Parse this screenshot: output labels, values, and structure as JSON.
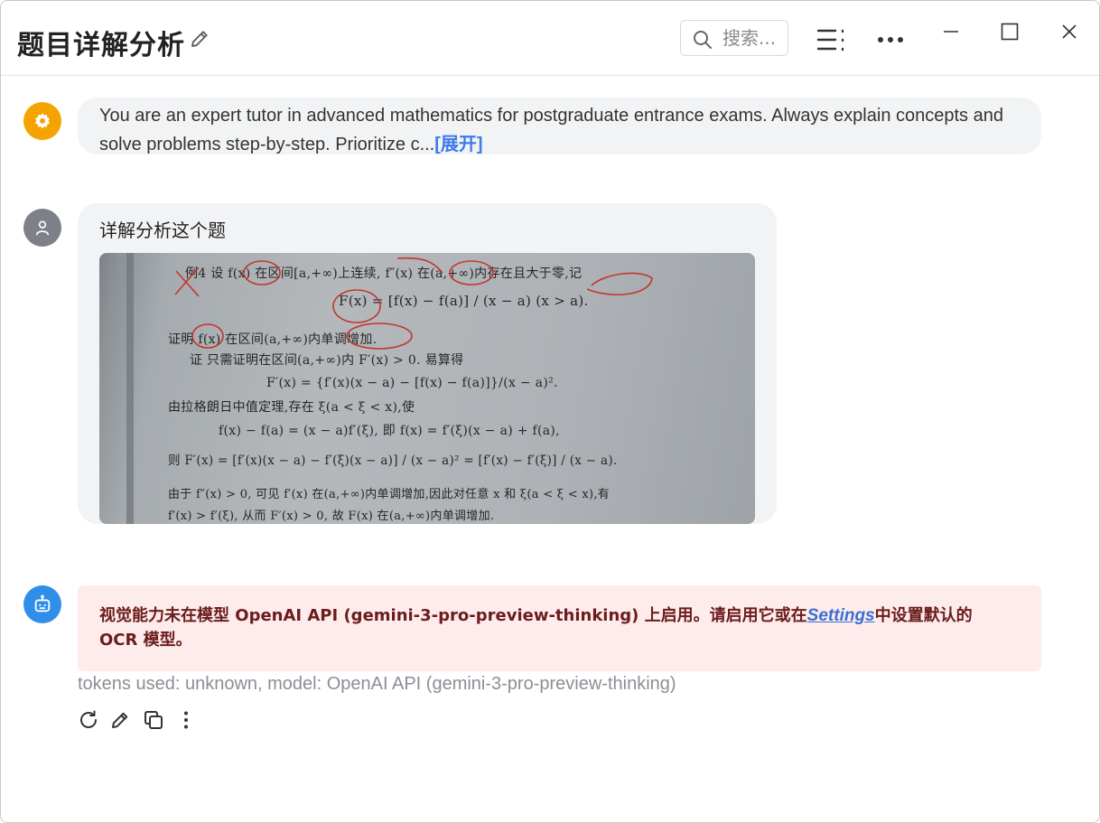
{
  "window": {
    "title": "题目详解分析",
    "search_placeholder": "搜索..."
  },
  "messages": {
    "system": {
      "text": "You are an expert tutor in advanced mathematics for postgraduate entrance exams. Always explain concepts and solve problems step-by-step. Prioritize c...",
      "expand_label": "[展开]"
    },
    "user": {
      "text": "详解分析这个题",
      "image_lines": [
        "例4  设 f(x) 在区间[a,+∞)上连续, f″(x) 在(a,+∞)内存在且大于零,记",
        "F(x) = [f(x) − f(a)] / (x − a)   (x > a).",
        "证明 f(x) 在区间(a,+∞)内单调增加.",
        "证  只需证明在区间(a,+∞)内 F′(x) > 0. 易算得",
        "F′(x) = {f′(x)(x − a) − [f(x) − f(a)]}/(x − a)².",
        "由拉格朗日中值定理,存在 ξ(a < ξ < x),使",
        "f(x) − f(a) = (x − a)f′(ξ),    即   f(x) = f′(ξ)(x − a) + f(a),",
        "则   F′(x) = [f′(x)(x − a) − f′(ξ)(x − a)] / (x − a)² = [f′(x) − f′(ξ)] / (x − a).",
        "由于 f″(x) > 0, 可见 f′(x) 在(a,+∞)内单调增加,因此对任意 x 和 ξ(a < ξ < x),有",
        "f′(x) > f′(ξ), 从而 F′(x) > 0, 故 F(x) 在(a,+∞)内单调增加."
      ]
    },
    "assistant": {
      "error_prefix": "视觉能力未在模型 OpenAI API (gemini-3-pro-preview-thinking) 上启用。请启用它或在",
      "error_link": "Settings",
      "error_suffix": "中设置默认的 OCR 模型。",
      "meta": "tokens used: unknown, model: OpenAI API (gemini-3-pro-preview-thinking)"
    }
  },
  "colors": {
    "system_avatar": "#f5a300",
    "user_avatar": "#7d8187",
    "assistant_avatar": "#2f8fe8",
    "expand_link": "#3b7bea",
    "error_bg": "#fdeceb",
    "error_text": "#6b1c1c"
  },
  "icons": {
    "title_edit": "pencil-icon",
    "search": "search-icon",
    "toc": "list-icon",
    "more": "more-horizontal-icon",
    "minimize": "minimize-icon",
    "maximize": "maximize-icon",
    "close": "close-icon",
    "system_avatar": "gear-icon",
    "user_avatar": "person-icon",
    "assistant_avatar": "robot-icon",
    "actions": [
      "refresh-icon",
      "pencil-icon",
      "copy-icon",
      "more-vertical-icon"
    ]
  }
}
